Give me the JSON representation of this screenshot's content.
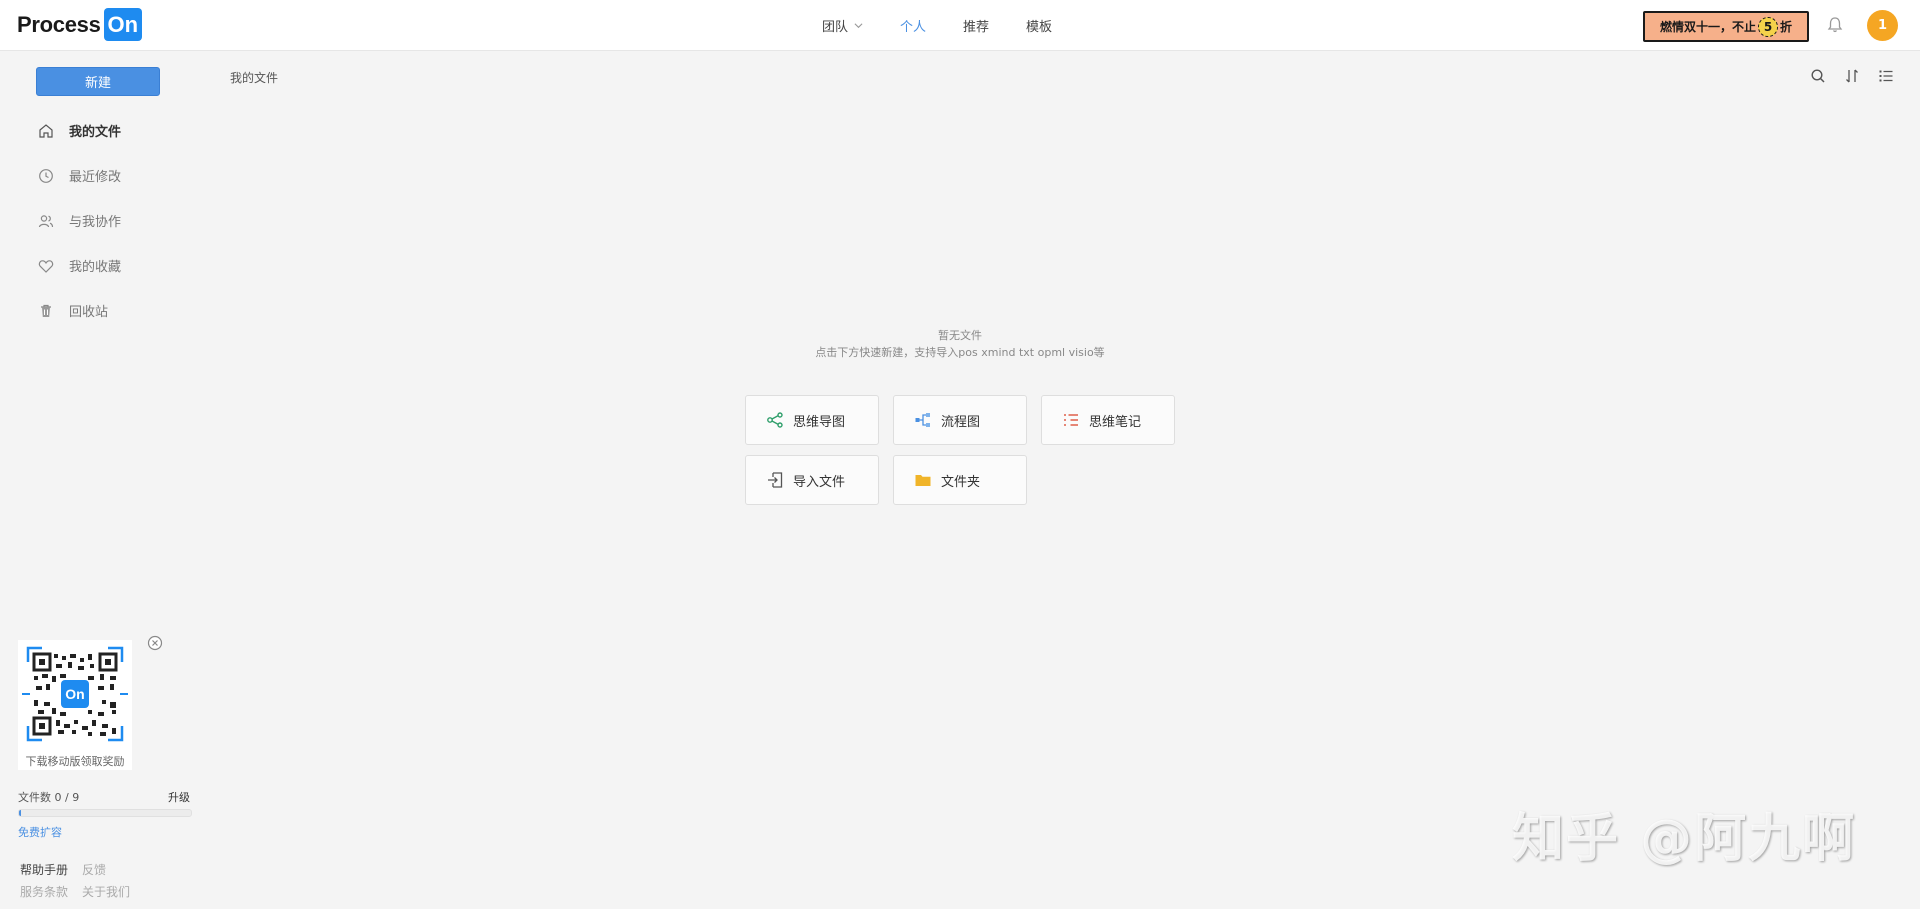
{
  "header": {
    "logo_text": "Process",
    "logo_on": "On",
    "nav": [
      {
        "label": "团队",
        "has_dropdown": true,
        "active": false
      },
      {
        "label": "个人",
        "active": true
      },
      {
        "label": "推荐",
        "active": false
      },
      {
        "label": "模板",
        "active": false
      }
    ],
    "promo": {
      "text_before": "燃情双十一，不止",
      "badge": "5",
      "text_after": "折"
    },
    "avatar_label": "1"
  },
  "sidebar": {
    "new_button": "新建",
    "items": [
      {
        "label": "我的文件",
        "icon": "home-icon",
        "active": true
      },
      {
        "label": "最近修改",
        "icon": "clock-icon",
        "active": false
      },
      {
        "label": "与我协作",
        "icon": "users-icon",
        "active": false
      },
      {
        "label": "我的收藏",
        "icon": "heart-icon",
        "active": false
      },
      {
        "label": "回收站",
        "icon": "trash-icon",
        "active": false
      }
    ],
    "qr_caption": "下载移动版领取奖励",
    "qr_center": "On",
    "files_label": "文件数 0 / 9",
    "files_used_fraction": 0.01,
    "upgrade": "升级",
    "expand": "免费扩容",
    "footer": {
      "help": "帮助手册",
      "feedback": "反馈",
      "terms": "服务条款",
      "about": "关于我们"
    }
  },
  "main": {
    "breadcrumb": "我的文件",
    "toolbar_icons": [
      "search-icon",
      "sort-icon",
      "list-view-icon"
    ],
    "empty_title": "暂无文件",
    "empty_sub": "点击下方快速新建，支持导入pos xmind txt opml visio等",
    "cards": [
      {
        "label": "思维导图",
        "icon": "mindmap-icon",
        "color": "#2e9e6a"
      },
      {
        "label": "流程图",
        "icon": "flowchart-icon",
        "color": "#4a90e2"
      },
      {
        "label": "思维笔记",
        "icon": "notes-icon",
        "color": "#e0604a"
      },
      {
        "label": "导入文件",
        "icon": "import-icon",
        "color": "#555555"
      },
      {
        "label": "文件夹",
        "icon": "folder-icon",
        "color": "#f0b429"
      }
    ]
  },
  "watermark": "知乎 @阿九啊",
  "colors": {
    "accent": "#4a90e2",
    "promo_bg": "#f6b08a",
    "avatar": "#f5a623"
  }
}
